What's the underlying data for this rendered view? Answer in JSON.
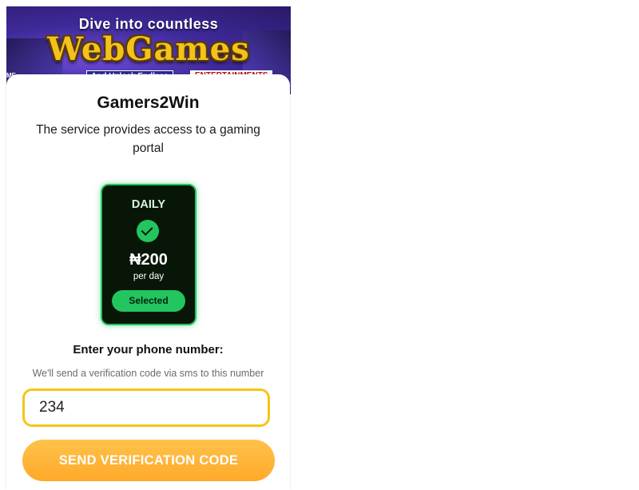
{
  "banner": {
    "line1": "Dive into countless",
    "logo": "WebGames",
    "tag1": "And Unlock Endless",
    "tag2": "ENTERTAINMENTS",
    "partial_text": "ME"
  },
  "card": {
    "title": "Gamers2Win",
    "description": "The service provides access to a gaming portal"
  },
  "plan": {
    "name": "DAILY",
    "price": "₦200",
    "period": "per day",
    "selected_label": "Selected",
    "check_icon": "check-circle-icon"
  },
  "phone": {
    "label": "Enter your phone number:",
    "hint": "We'll send a verification code via sms to this number",
    "value": "234"
  },
  "actions": {
    "send_label": "SEND VERIFICATION CODE"
  },
  "colors": {
    "accent_green": "#22c55e",
    "input_border": "#f5c518",
    "button": "#ffb13a"
  }
}
